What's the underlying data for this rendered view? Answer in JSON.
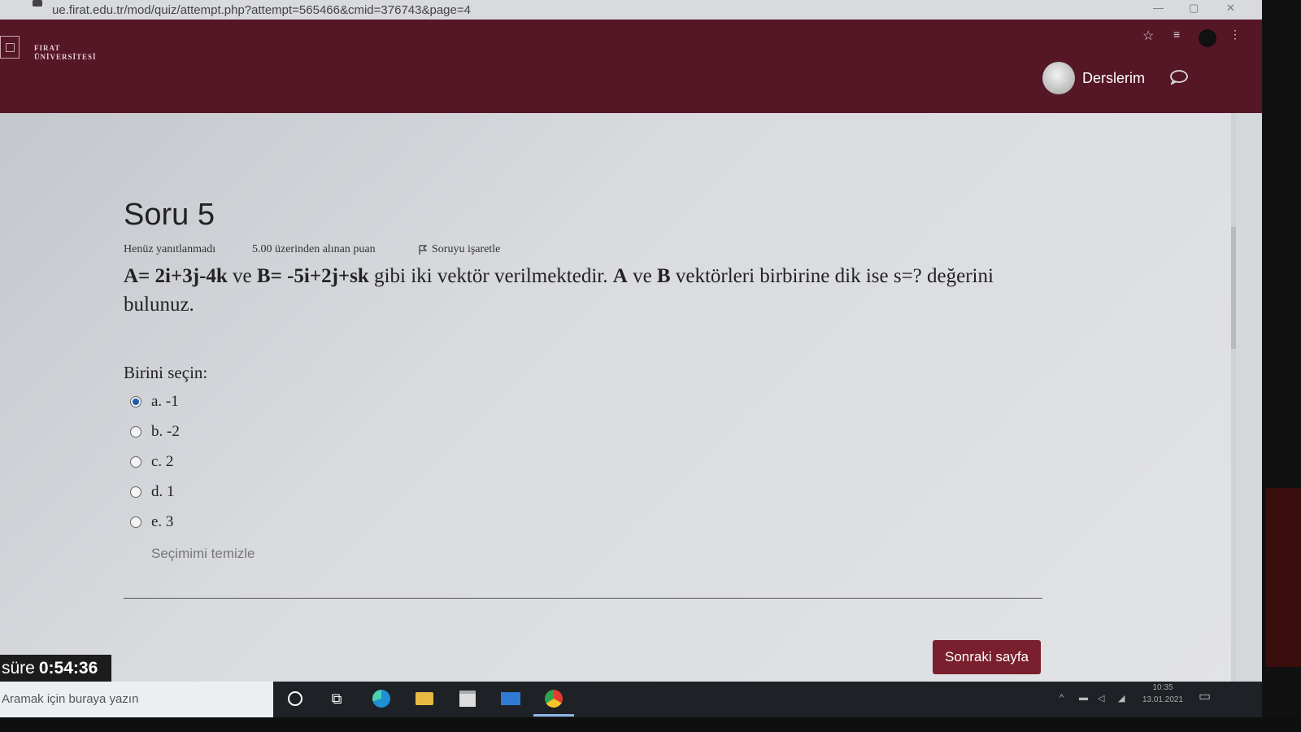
{
  "browser": {
    "url": "ue.firat.edu.tr/mod/quiz/attempt.php?attempt=565466&cmid=376743&page=4"
  },
  "header": {
    "logo_text_line1": "FIRAT",
    "logo_text_line2": "ÜNİVERSİTESİ",
    "nav_label": "Derslerim",
    "accent_color": "#551626"
  },
  "question": {
    "title": "Soru 5",
    "state": "Henüz yanıtlanmadı",
    "grade": "5.00 üzerinden alınan puan",
    "flag_label": "Soruyu işaretle",
    "text": {
      "p1": "A= 2i+3j-4k",
      "p2": " ve ",
      "p3": "B= -5i+2j+sk",
      "p4": " gibi iki vektör verilmektedir. ",
      "p5": "A",
      "p6": " ve ",
      "p7": "B",
      "p8": " vektörleri birbirine dik ise s=? değerini bulunuz."
    },
    "prompt": "Birini seçin:",
    "options": [
      {
        "label": "a. -1",
        "selected": true
      },
      {
        "label": "b. -2",
        "selected": false
      },
      {
        "label": "c. 2",
        "selected": false
      },
      {
        "label": "d. 1",
        "selected": false
      },
      {
        "label": "e. 3",
        "selected": false
      }
    ],
    "clear_choice": "Seçimimi temizle"
  },
  "navigation": {
    "next_page": "Sonraki sayfa"
  },
  "timer": {
    "label": "süre",
    "value": "0:54:36"
  },
  "taskbar": {
    "search_placeholder": "Aramak için buraya yazın",
    "time": "10:35",
    "date": "13.01.2021"
  }
}
